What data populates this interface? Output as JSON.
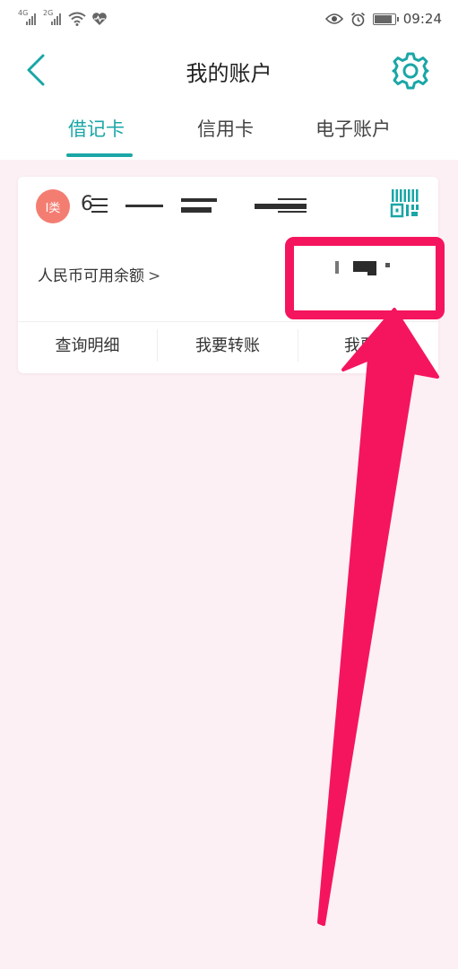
{
  "status_bar": {
    "signal1_network": "4G",
    "signal2_network": "2G",
    "time": "09:24"
  },
  "header": {
    "title": "我的账户"
  },
  "tabs": [
    {
      "label": "借记卡",
      "active": true
    },
    {
      "label": "信用卡",
      "active": false
    },
    {
      "label": "电子账户",
      "active": false
    }
  ],
  "card": {
    "type_badge": "I类",
    "card_number_visible": "6",
    "balance_label": "人民币可用余额",
    "balance_chevron": ">",
    "actions": [
      {
        "label": "查询明细"
      },
      {
        "label": "我要转账"
      },
      {
        "label": "我要理"
      }
    ]
  },
  "colors": {
    "accent": "#1aa6a6",
    "badge": "#f47d72",
    "highlight": "#f5155f",
    "background": "#fdf0f4"
  },
  "icons": {
    "back": "chevron-left-icon",
    "settings": "gear-icon",
    "qr": "qr-code-icon",
    "eye": "eye-icon",
    "alarm": "alarm-icon",
    "wifi": "wifi-icon",
    "heart": "heart-pulse-icon",
    "battery": "battery-icon"
  }
}
